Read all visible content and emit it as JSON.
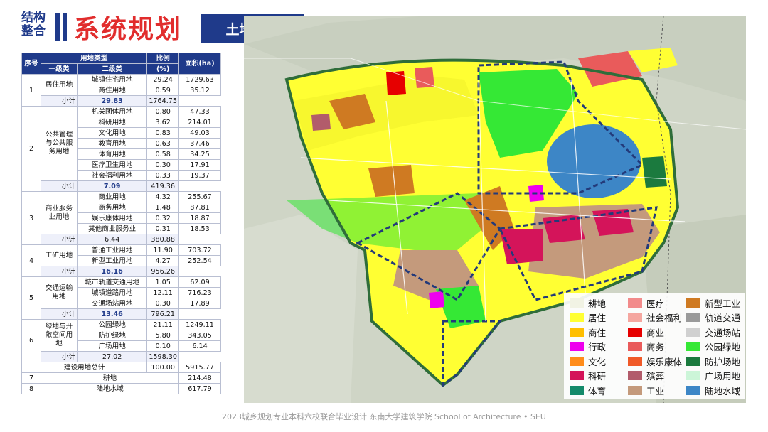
{
  "header": {
    "tag_line1": "结构",
    "tag_line2": "整合",
    "title": "系统规划",
    "subtitle": "土地利用"
  },
  "table": {
    "headers": {
      "no": "序号",
      "land_type": "用地类型",
      "ratio": "比例",
      "ratio_unit": "(%)",
      "area": "面积(ha)",
      "level1": "一级类",
      "level2": "二级类"
    },
    "rows": [
      {
        "no": "1",
        "cat": "居住用地",
        "sub": "城镇住宅用地",
        "pct": "29.24",
        "area": "1729.63"
      },
      {
        "no": "",
        "cat": "",
        "sub": "商住用地",
        "pct": "0.59",
        "area": "35.12"
      },
      {
        "no": "",
        "cat": "",
        "sub": "小计",
        "pct": "29.83",
        "area": "1764.75",
        "subtotal": true
      },
      {
        "no": "2",
        "cat": "公共管理与公共服务用地",
        "sub": "机关团体用地",
        "pct": "0.80",
        "area": "47.33"
      },
      {
        "no": "",
        "cat": "",
        "sub": "科研用地",
        "pct": "3.62",
        "area": "214.01"
      },
      {
        "no": "",
        "cat": "",
        "sub": "文化用地",
        "pct": "0.83",
        "area": "49.03"
      },
      {
        "no": "",
        "cat": "",
        "sub": "教育用地",
        "pct": "0.63",
        "area": "37.46"
      },
      {
        "no": "",
        "cat": "",
        "sub": "体育用地",
        "pct": "0.58",
        "area": "34.25"
      },
      {
        "no": "",
        "cat": "",
        "sub": "医疗卫生用地",
        "pct": "0.30",
        "area": "17.91"
      },
      {
        "no": "",
        "cat": "",
        "sub": "社会福利用地",
        "pct": "0.33",
        "area": "19.37"
      },
      {
        "no": "",
        "cat": "",
        "sub": "小计",
        "pct": "7.09",
        "area": "419.36",
        "subtotal": true
      },
      {
        "no": "3",
        "cat": "商业服务业用地",
        "sub": "商业用地",
        "pct": "4.32",
        "area": "255.67"
      },
      {
        "no": "",
        "cat": "",
        "sub": "商务用地",
        "pct": "1.48",
        "area": "87.81"
      },
      {
        "no": "",
        "cat": "",
        "sub": "娱乐康体用地",
        "pct": "0.32",
        "area": "18.87"
      },
      {
        "no": "",
        "cat": "",
        "sub": "其他商业服务业",
        "pct": "0.31",
        "area": "18.53"
      },
      {
        "no": "",
        "cat": "",
        "sub": "小计",
        "pct": "6.44",
        "area": "380.88",
        "subtotal": true,
        "plain": true
      },
      {
        "no": "4",
        "cat": "工矿用地",
        "sub": "普通工业用地",
        "pct": "11.90",
        "area": "703.72"
      },
      {
        "no": "",
        "cat": "",
        "sub": "新型工业用地",
        "pct": "4.27",
        "area": "252.54"
      },
      {
        "no": "",
        "cat": "",
        "sub": "小计",
        "pct": "16.16",
        "area": "956.26",
        "subtotal": true
      },
      {
        "no": "5",
        "cat": "交通运输用地",
        "sub": "城市轨道交通用地",
        "pct": "1.05",
        "area": "62.09"
      },
      {
        "no": "",
        "cat": "",
        "sub": "城镇道路用地",
        "pct": "12.11",
        "area": "716.23"
      },
      {
        "no": "",
        "cat": "",
        "sub": "交通场站用地",
        "pct": "0.30",
        "area": "17.89"
      },
      {
        "no": "",
        "cat": "",
        "sub": "小计",
        "pct": "13.46",
        "area": "796.21",
        "subtotal": true
      },
      {
        "no": "6",
        "cat": "绿地与开敞空间用地",
        "sub": "公园绿地",
        "pct": "21.11",
        "area": "1249.11"
      },
      {
        "no": "",
        "cat": "",
        "sub": "防护绿地",
        "pct": "5.80",
        "area": "343.05"
      },
      {
        "no": "",
        "cat": "",
        "sub": "广场用地",
        "pct": "0.10",
        "area": "6.14"
      },
      {
        "no": "",
        "cat": "",
        "sub": "小计",
        "pct": "27.02",
        "area": "1598.30",
        "subtotal": true,
        "plain": true
      }
    ],
    "total": {
      "label": "建设用地总计",
      "pct": "100.00",
      "area": "5915.77"
    },
    "extra": [
      {
        "no": "7",
        "cat": "耕地",
        "area": "214.48"
      },
      {
        "no": "8",
        "cat": "陆地水域",
        "area": "617.79"
      }
    ]
  },
  "legend": [
    {
      "label": "耕地",
      "color": "#f1f3e4"
    },
    {
      "label": "医疗",
      "color": "#f28b8b"
    },
    {
      "label": "新型工业",
      "color": "#cf7a22"
    },
    {
      "label": "居住",
      "color": "#ffff33"
    },
    {
      "label": "社会福利",
      "color": "#f5a7a0"
    },
    {
      "label": "轨道交通",
      "color": "#9a9a9a"
    },
    {
      "label": "商住",
      "color": "#ffbf00"
    },
    {
      "label": "商业",
      "color": "#e60000"
    },
    {
      "label": "交通场站",
      "color": "#d0d0d0"
    },
    {
      "label": "行政",
      "color": "#ee00ee"
    },
    {
      "label": "商务",
      "color": "#e95b5b"
    },
    {
      "label": "公园绿地",
      "color": "#35e835"
    },
    {
      "label": "文化",
      "color": "#ff8c1a"
    },
    {
      "label": "娱乐康体",
      "color": "#f05a28"
    },
    {
      "label": "防护场地",
      "color": "#1b7a3e"
    },
    {
      "label": "科研",
      "color": "#d4145a"
    },
    {
      "label": "殡葬",
      "color": "#b25c6b"
    },
    {
      "label": "广场用地",
      "color": "#ccf5d8"
    },
    {
      "label": "体育",
      "color": "#148a6a"
    },
    {
      "label": "工业",
      "color": "#c49a7c"
    },
    {
      "label": "陆地水域",
      "color": "#3d86c6"
    }
  ],
  "footer": "2023城乡规划专业本科六校联合毕业设计    东南大学建筑学院    School of Architecture • SEU"
}
